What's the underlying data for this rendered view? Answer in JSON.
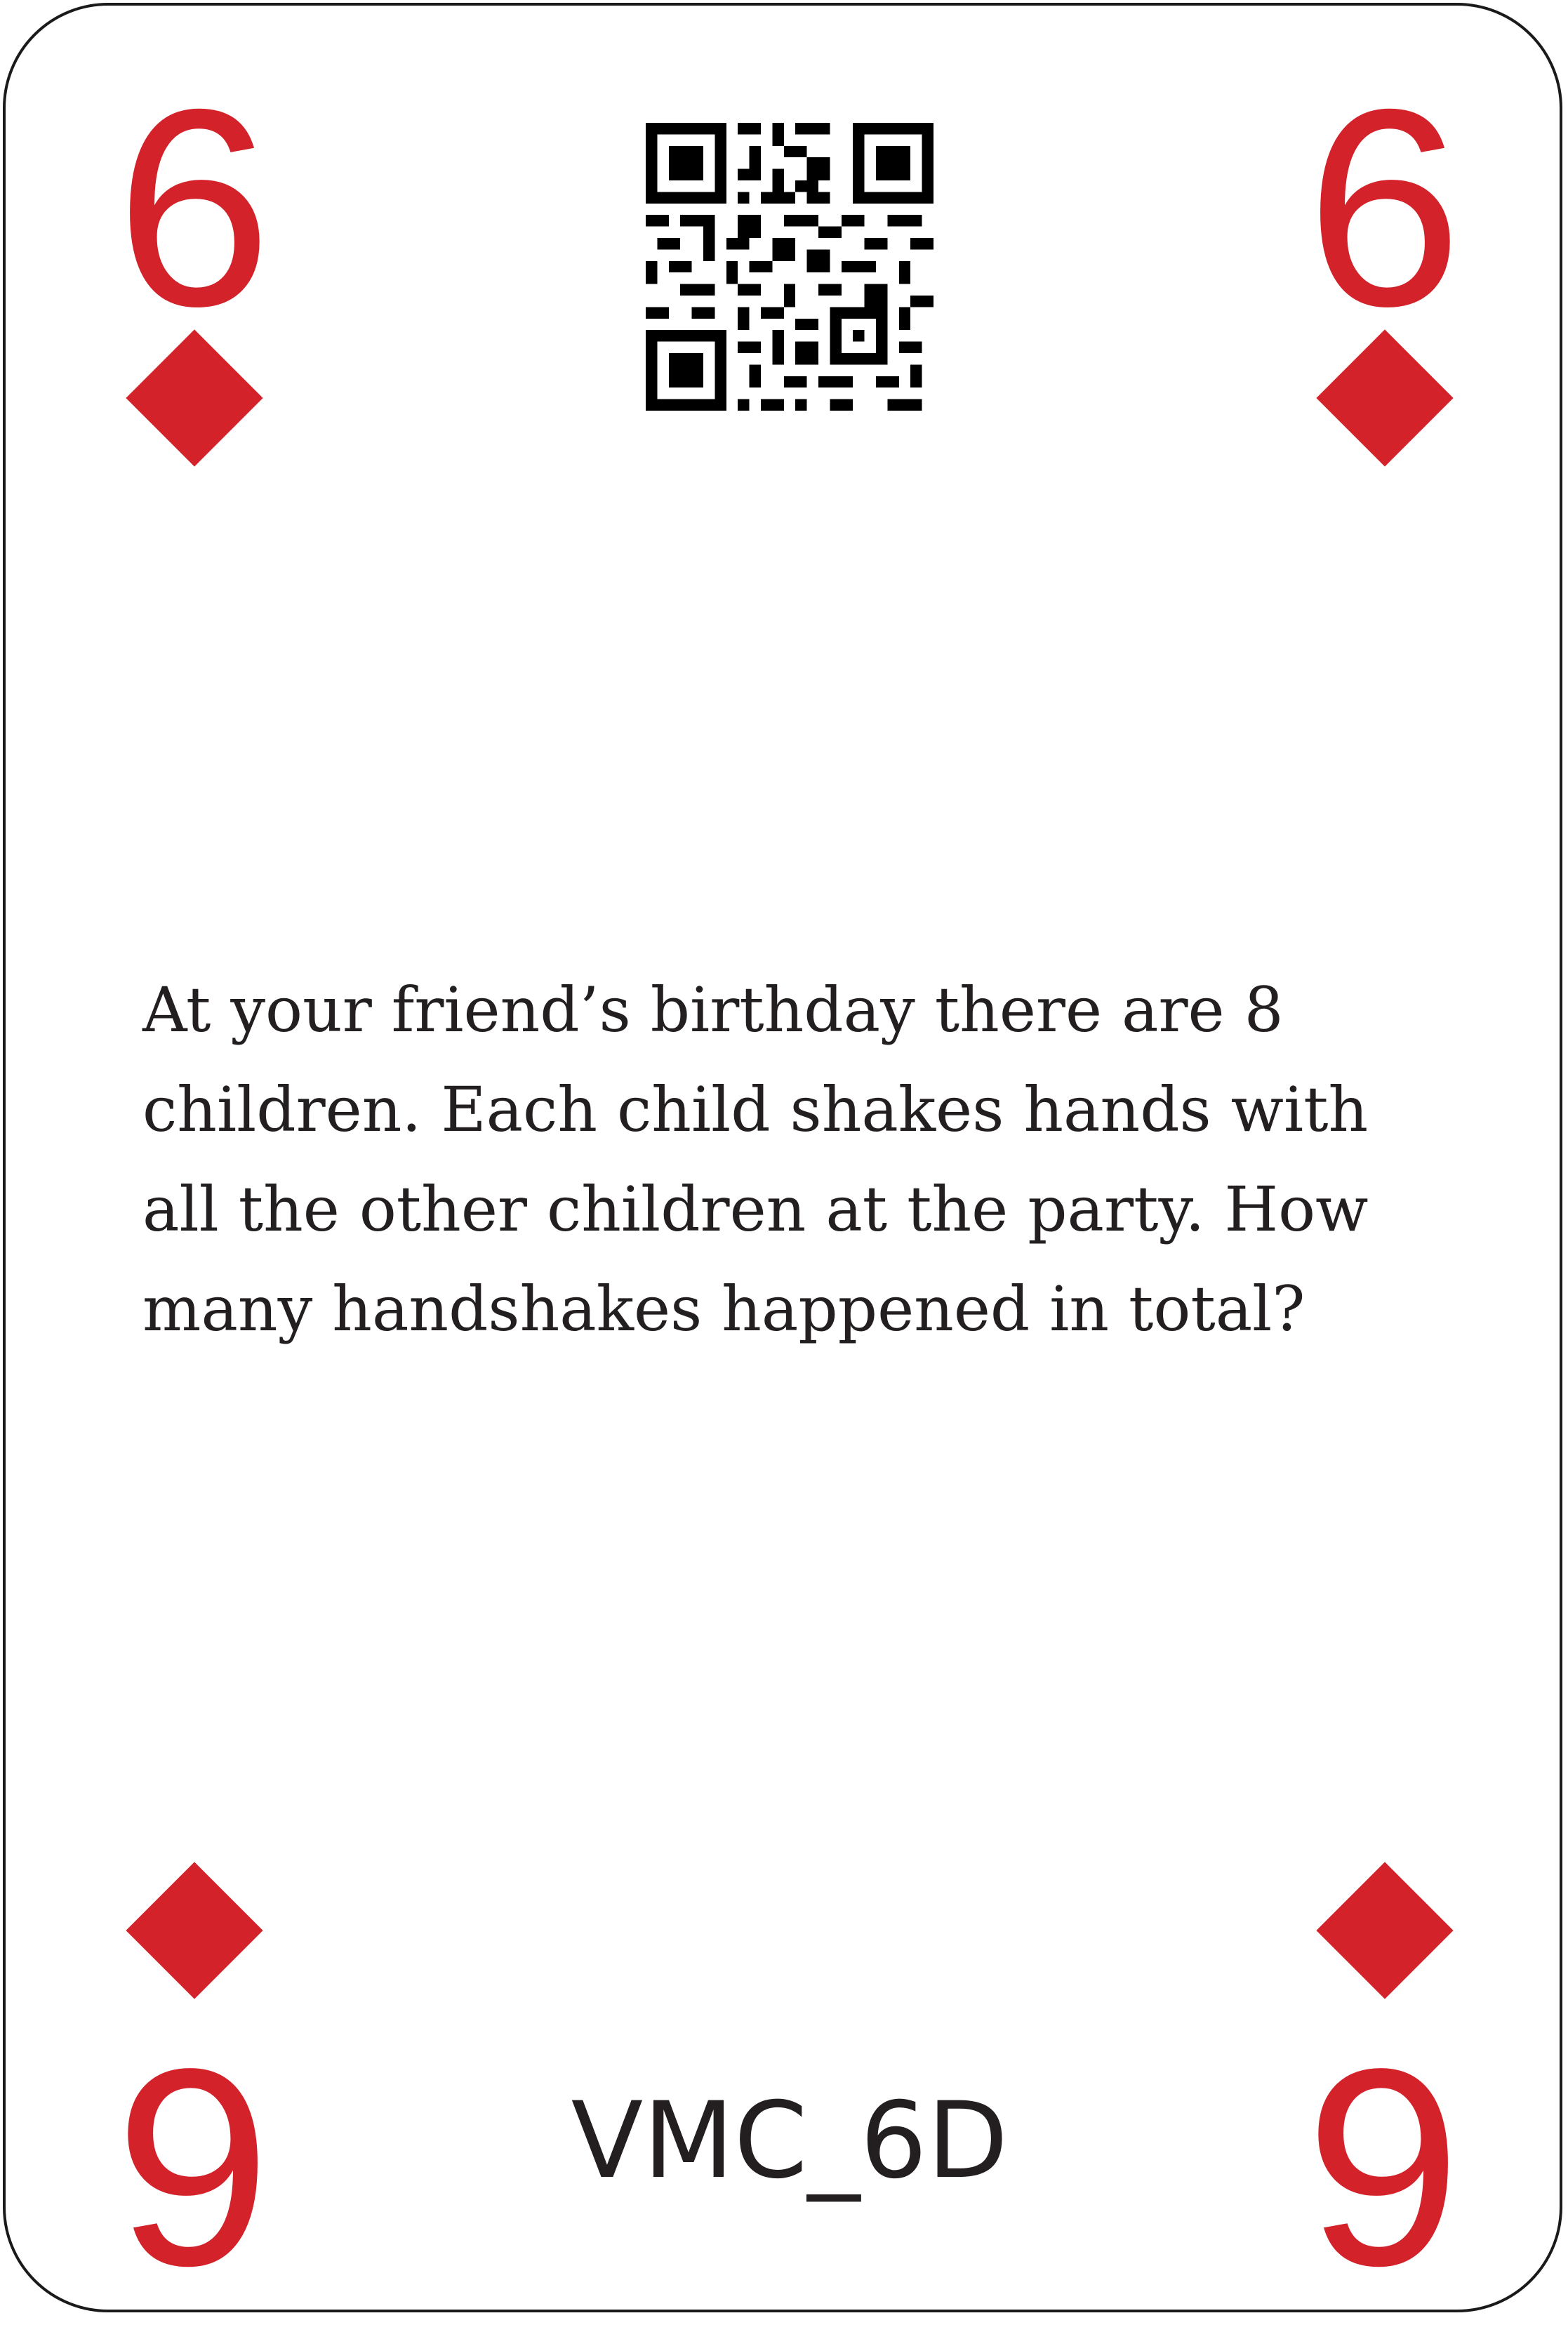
{
  "card": {
    "rank": "6",
    "rank_inverted": "6",
    "suit": "diamond",
    "suit_color": "#d3222a",
    "question": "At your friend’s birthday there are 8 children. Each child shakes hands with all the other children at the party. How many handshakes happened in total?",
    "code": "VMC_6D",
    "qr_icon": "qr-code-icon"
  }
}
